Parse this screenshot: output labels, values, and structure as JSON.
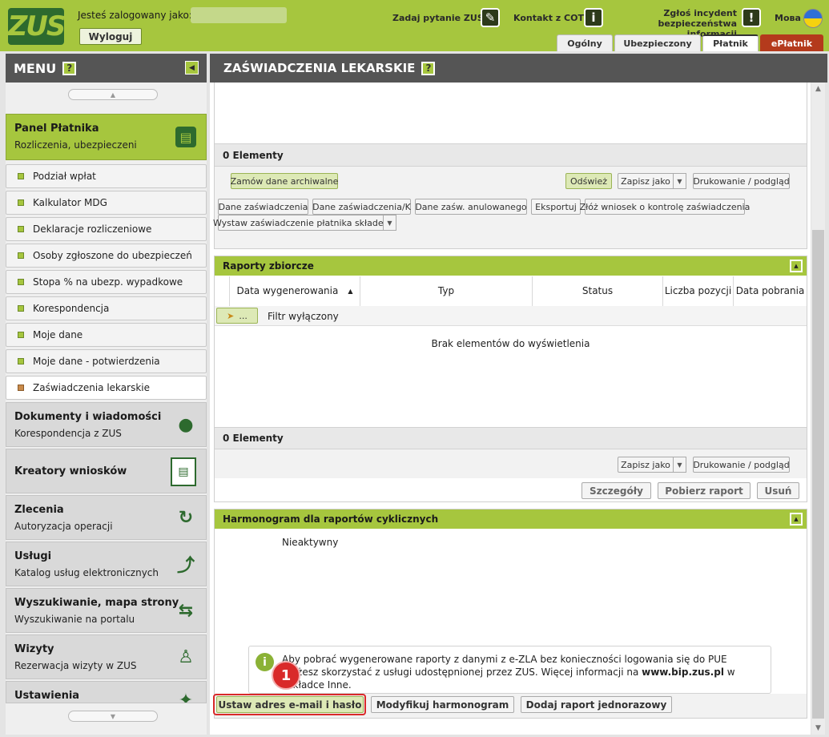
{
  "header": {
    "logo_text": "ZUS",
    "logged_label": "Jesteś zalogowany jako:",
    "logout_label": "Wyloguj",
    "ask_label": "Zadaj pytanie ZUS",
    "contact_label": "Kontakt z COT",
    "incident_line1": "Zgłoś incydent",
    "incident_line2": "bezpieczeństwa informacji",
    "language_label": "Мова",
    "tabs": [
      {
        "label": "Ogólny"
      },
      {
        "label": "Ubezpieczony"
      },
      {
        "label": "Płatnik"
      },
      {
        "label": "ePłatnik"
      }
    ]
  },
  "sidebar": {
    "title": "MENU",
    "help": "?",
    "panel": {
      "name": "Panel Płatnika",
      "sub": "Rozliczenia, ubezpieczeni"
    },
    "items": [
      {
        "label": "Podział wpłat"
      },
      {
        "label": "Kalkulator MDG"
      },
      {
        "label": "Deklaracje rozliczeniowe"
      },
      {
        "label": "Osoby zgłoszone do ubezpieczeń"
      },
      {
        "label": "Stopa % na ubezp. wypadkowe"
      },
      {
        "label": "Korespondencja"
      },
      {
        "label": "Moje dane"
      },
      {
        "label": "Moje dane - potwierdzenia"
      },
      {
        "label": "Zaświadczenia lekarskie"
      }
    ],
    "sections": [
      {
        "name": "Dokumenty i wiadomości",
        "sub": "Korespondencja z ZUS"
      },
      {
        "name": "Kreatory wniosków",
        "sub": ""
      },
      {
        "name": "Zlecenia",
        "sub": "Autoryzacja operacji"
      },
      {
        "name": "Usługi",
        "sub": "Katalog usług elektronicznych"
      },
      {
        "name": "Wyszukiwanie, mapa strony",
        "sub": "Wyszukiwanie na portalu"
      },
      {
        "name": "Wizyty",
        "sub": "Rezerwacja wizyty w ZUS"
      },
      {
        "name": "Ustawienia",
        "sub": ""
      }
    ]
  },
  "main": {
    "title": "ZAŚWIADCZENIA LEKARSKIE",
    "help": "?",
    "top": {
      "count": "0 Elementy",
      "order_archive": "Zamów dane archiwalne",
      "refresh": "Odśwież",
      "save_as": "Zapisz jako",
      "print": "Drukowanie / podgląd",
      "actions": [
        {
          "label": "Dane zaświadczenia"
        },
        {
          "label": "Dane zaświadczenia/K"
        },
        {
          "label": "Dane zaśw. anulowanego"
        },
        {
          "label": "Eksportuj"
        },
        {
          "label": "Złóż wniosek o kontrolę zaświadczenia"
        },
        {
          "label": "Wystaw zaświadczenie płatnika składek"
        }
      ]
    },
    "reports": {
      "title": "Raporty zbiorcze",
      "columns": [
        {
          "label": "Data wygenerowania"
        },
        {
          "label": "Typ"
        },
        {
          "label": "Status"
        },
        {
          "label": "Liczba pozycji"
        },
        {
          "label": "Data pobrania"
        }
      ],
      "filter_btn": "...",
      "filter_label": "Filtr wyłączony",
      "empty": "Brak elementów do wyświetlenia",
      "count": "0 Elementy",
      "save_as": "Zapisz jako",
      "print": "Drukowanie / podgląd",
      "details": "Szczegóły",
      "download": "Pobierz raport",
      "delete": "Usuń"
    },
    "schedule": {
      "title": "Harmonogram dla raportów cyklicznych",
      "status": "Nieaktywny",
      "info_line1": "Aby pobrać wygenerowane raporty z danymi z e-ZLA bez konieczności logowania się do PUE",
      "info_line2_a": "możesz skorzystać z usługi udostępnionej przez ZUS. Więcej informacji na ",
      "info_link": "www.bip.zus.pl",
      "info_line2_b": " w",
      "info_line3": "zakładce Inne.",
      "badge": "1",
      "set_email": "Ustaw adres e-mail i hasło",
      "modify": "Modyfikuj harmonogram",
      "add_one": "Dodaj raport jednorazowy"
    }
  },
  "colors": {
    "accent": "#a6c63e",
    "header_dark": "#555555",
    "highlight_red": "#d92a2a"
  }
}
